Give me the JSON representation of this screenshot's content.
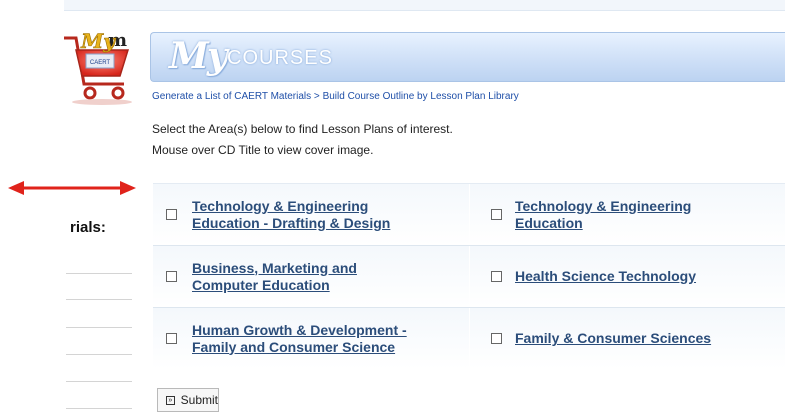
{
  "left_partial": {
    "heading_fragment": "m",
    "materials_fragment": "rials:"
  },
  "banner": {
    "my": "My",
    "courses": "COURSES",
    "logo_text": "CAERT"
  },
  "breadcrumb": {
    "step1": "Generate a List of CAERT Materials",
    "separator": " > ",
    "step2": "Build Course Outline by Lesson Plan Library"
  },
  "instructions": {
    "line1": "Select the Area(s) below to find Lesson Plans of interest.",
    "line2": "Mouse over CD Title to view cover image."
  },
  "areas": [
    {
      "label": "Technology & Engineering\nEducation - Drafting & Design",
      "checked": false
    },
    {
      "label": "Technology & Engineering\nEducation",
      "checked": false
    },
    {
      "label": "Business, Marketing and\nComputer Education",
      "checked": false
    },
    {
      "label": "Health Science Technology",
      "checked": false
    },
    {
      "label": "Human Growth & Development -\nFamily and Consumer Science",
      "checked": false
    },
    {
      "label": "Family & Consumer Sciences",
      "checked": false
    }
  ],
  "submit_label": "Submit",
  "colors": {
    "link": "#2b4d7a",
    "breadcrumb": "#1f4fa8",
    "arrow": "#e0231b"
  },
  "icons": {
    "cart": "shopping-cart-icon",
    "arrow": "double-arrow-icon",
    "submit": "submit-icon"
  }
}
